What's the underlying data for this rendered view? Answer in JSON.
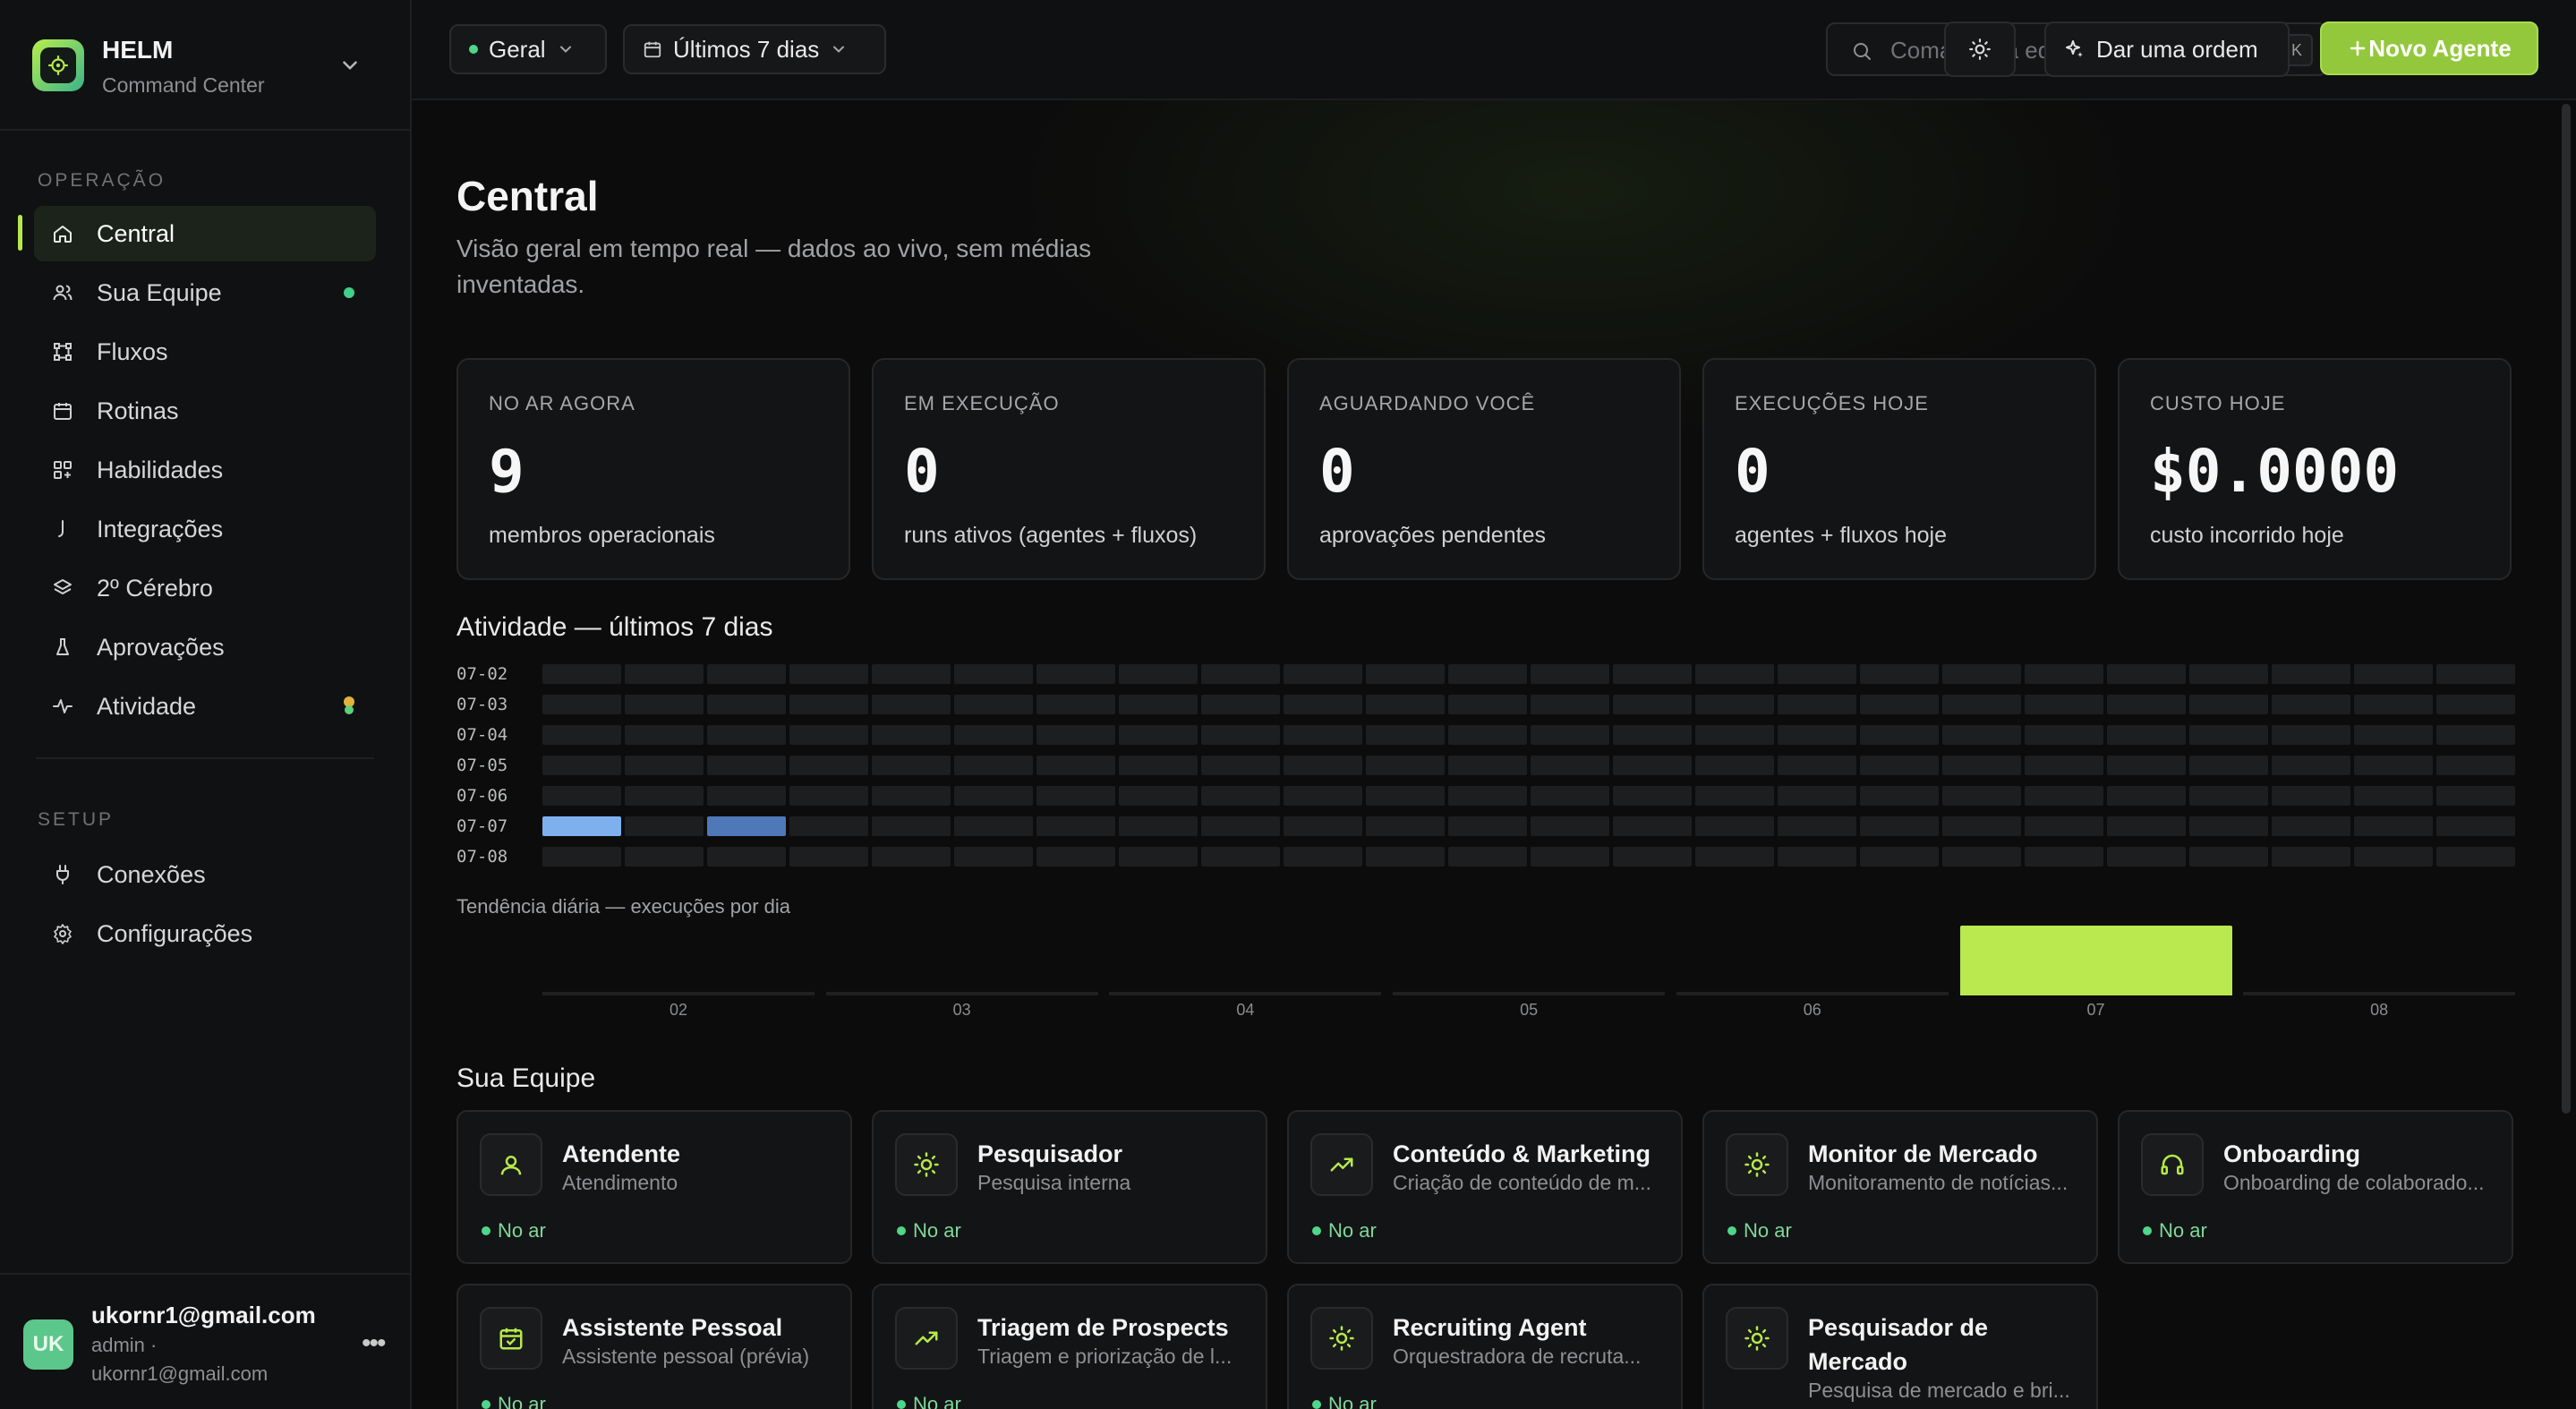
{
  "brand": {
    "name": "HELM",
    "subtitle": "Command Center"
  },
  "sidebar": {
    "sections": [
      {
        "title": "OPERAÇÃO"
      },
      {
        "title": "SETUP"
      }
    ],
    "items": [
      {
        "label": "Central",
        "icon": "home-icon",
        "active": true
      },
      {
        "label": "Sua Equipe",
        "icon": "users-icon",
        "badge": "green"
      },
      {
        "label": "Fluxos",
        "icon": "workflow-icon"
      },
      {
        "label": "Rotinas",
        "icon": "calendar-icon"
      },
      {
        "label": "Habilidades",
        "icon": "grid-plus-icon"
      },
      {
        "label": "Integrações",
        "icon": "plug-icon"
      },
      {
        "label": "2º Cérebro",
        "icon": "layers-icon"
      },
      {
        "label": "Aprovações",
        "icon": "flask-icon"
      },
      {
        "label": "Atividade",
        "icon": "activity-icon",
        "badge": "amber-green"
      },
      {
        "label": "Conexões",
        "icon": "connector-icon"
      },
      {
        "label": "Configurações",
        "icon": "gear-icon"
      }
    ]
  },
  "user": {
    "initials": "UK",
    "name": "ukornr1@gmail.com",
    "role": "admin ·",
    "email": "ukornr1@gmail.com"
  },
  "topbar": {
    "workspace": "Geral",
    "range": "Últimos 7 dias",
    "search_placeholder": "Comandar a equipe · buscar",
    "search_shortcut": "⌘K",
    "order_button": "Dar uma ordem",
    "new_agent_button": "Novo Agente"
  },
  "page": {
    "title": "Central",
    "subtitle": "Visão geral em tempo real — dados ao vivo, sem médias inventadas."
  },
  "stats": [
    {
      "label": "NO AR AGORA",
      "value": "9",
      "desc": "membros operacionais"
    },
    {
      "label": "EM EXECUÇÃO",
      "value": "0",
      "desc": "runs ativos (agentes + fluxos)"
    },
    {
      "label": "AGUARDANDO VOCÊ",
      "value": "0",
      "desc": "aprovações pendentes"
    },
    {
      "label": "EXECUÇÕES HOJE",
      "value": "0",
      "desc": "agentes + fluxos hoje"
    },
    {
      "label": "CUSTO HOJE",
      "value": "$0.0000",
      "desc": "custo incorrido hoje"
    }
  ],
  "activity": {
    "title": "Atividade — últimos 7 dias",
    "rows": [
      "07-02",
      "07-03",
      "07-04",
      "07-05",
      "07-06",
      "07-07",
      "07-08"
    ],
    "columns": 24,
    "highlights": [
      {
        "row": 5,
        "col": 0,
        "color": "#7fb0ee"
      },
      {
        "row": 5,
        "col": 2,
        "color": "#4e78b8"
      }
    ]
  },
  "chart_data": {
    "type": "bar",
    "title": "Tendência diária — execuções por dia",
    "categories": [
      "02",
      "03",
      "04",
      "05",
      "06",
      "07",
      "08"
    ],
    "values": [
      0,
      0,
      0,
      0,
      0,
      1,
      0
    ],
    "ylim": [
      0,
      1
    ],
    "xlabel": "",
    "ylabel": "",
    "color": "#b9e94f"
  },
  "team": {
    "title": "Sua Equipe",
    "agents": [
      {
        "name": "Atendente",
        "desc": "Atendimento",
        "status": "No ar",
        "icon": "user-headset-icon"
      },
      {
        "name": "Pesquisador",
        "desc": "Pesquisa interna",
        "status": "No ar",
        "icon": "sun-icon"
      },
      {
        "name": "Conteúdo & Marketing",
        "desc": "Criação de conteúdo de m...",
        "status": "No ar",
        "icon": "trend-up-icon"
      },
      {
        "name": "Monitor de Mercado",
        "desc": "Monitoramento de notícias...",
        "status": "No ar",
        "icon": "sun-icon"
      },
      {
        "name": "Onboarding",
        "desc": "Onboarding de colaborado...",
        "status": "No ar",
        "icon": "headphones-icon"
      },
      {
        "name": "Assistente Pessoal",
        "desc": "Assistente pessoal (prévia)",
        "status": "No ar",
        "icon": "calendar-check-icon"
      },
      {
        "name": "Triagem de Prospects",
        "desc": "Triagem e priorização de l...",
        "status": "No ar",
        "icon": "trend-up-icon"
      },
      {
        "name": "Recruiting Agent",
        "desc": "Orquestradora de recruta...",
        "status": "No ar",
        "icon": "sun-icon"
      },
      {
        "name": "Pesquisador de Mercado",
        "desc": "Pesquisa de mercado e bri...",
        "status": "",
        "icon": "sun-icon"
      }
    ]
  }
}
